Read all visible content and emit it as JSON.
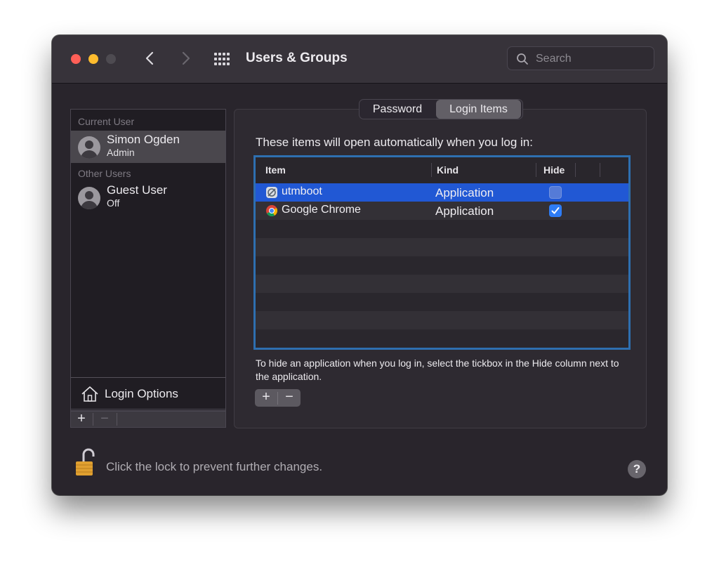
{
  "window": {
    "title": "Users & Groups"
  },
  "search": {
    "placeholder": "Search"
  },
  "sidebar": {
    "current_user_label": "Current User",
    "other_users_label": "Other Users",
    "users": [
      {
        "name": "Simon Ogden",
        "role": "Admin"
      },
      {
        "name": "Guest User",
        "role": "Off"
      }
    ],
    "login_options_label": "Login Options",
    "add_label": "+",
    "remove_label": "−"
  },
  "tabs": [
    {
      "label": "Password",
      "selected": false
    },
    {
      "label": "Login Items",
      "selected": true
    }
  ],
  "login_items": {
    "heading": "These items will open automatically when you log in:",
    "columns": [
      "Item",
      "Kind",
      "Hide"
    ],
    "rows": [
      {
        "item": "utmboot",
        "kind": "Application",
        "hide": false,
        "selected": true,
        "icon": "utmboot-app-icon"
      },
      {
        "item": "Google Chrome",
        "kind": "Application",
        "hide": true,
        "selected": false,
        "icon": "chrome-icon"
      }
    ],
    "hint": "To hide an application when you log in, select the tickbox in the Hide column next to the application.",
    "add_label": "+",
    "remove_label": "−"
  },
  "footer": {
    "lock_text": "Click the lock to prevent further changes.",
    "help_label": "?"
  },
  "colors": {
    "selection": "#2158d4",
    "table_focus_ring": "#2e6fb0",
    "checkbox_checked": "#2e7cf6"
  }
}
